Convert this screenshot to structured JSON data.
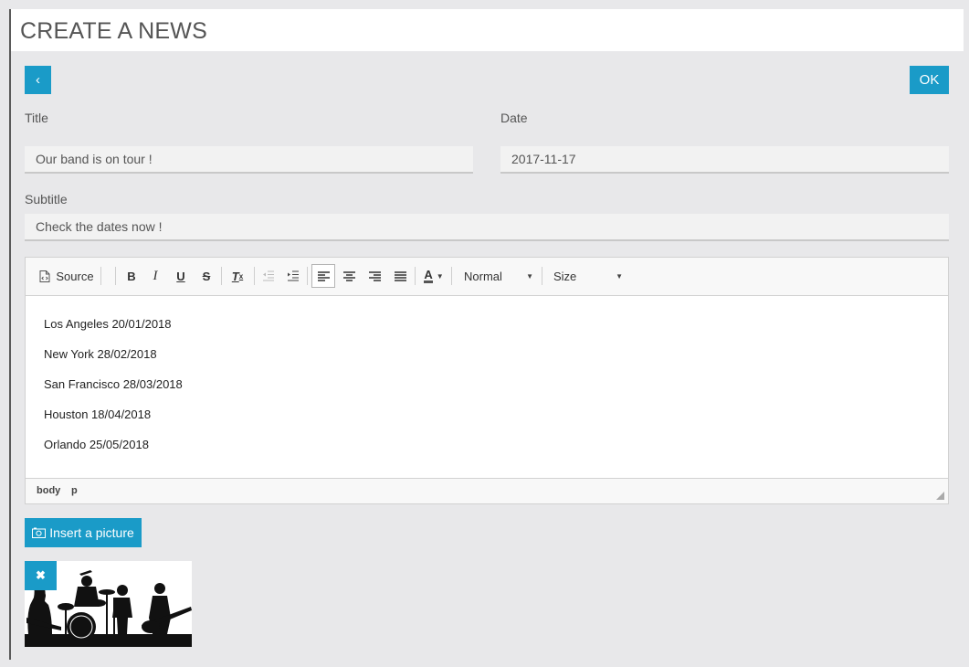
{
  "header": {
    "title": "CREATE A NEWS"
  },
  "actions": {
    "back_label": "‹",
    "ok_label": "OK"
  },
  "form": {
    "title_label": "Title",
    "title_value": "Our band is on tour !",
    "date_label": "Date",
    "date_value": "2017-11-17",
    "subtitle_label": "Subtitle",
    "subtitle_value": "Check the dates now !"
  },
  "toolbar": {
    "source_label": "Source",
    "bold_label": "B",
    "italic_label": "I",
    "underline_label": "U",
    "strike_label": "S",
    "clear_format_label": "T",
    "font_color_label": "A",
    "format_value": "Normal",
    "size_value": "Size"
  },
  "editor": {
    "lines": [
      "Los Angeles 20/01/2018",
      "New York 28/02/2018",
      "San Francisco 28/03/2018",
      "Houston 18/04/2018",
      "Orlando 25/05/2018"
    ],
    "path": [
      "body",
      "p"
    ]
  },
  "picture": {
    "insert_label": "Insert a picture",
    "remove_label": "✖"
  },
  "colors": {
    "accent": "#1a9bc8",
    "background": "#e8e8ea"
  }
}
